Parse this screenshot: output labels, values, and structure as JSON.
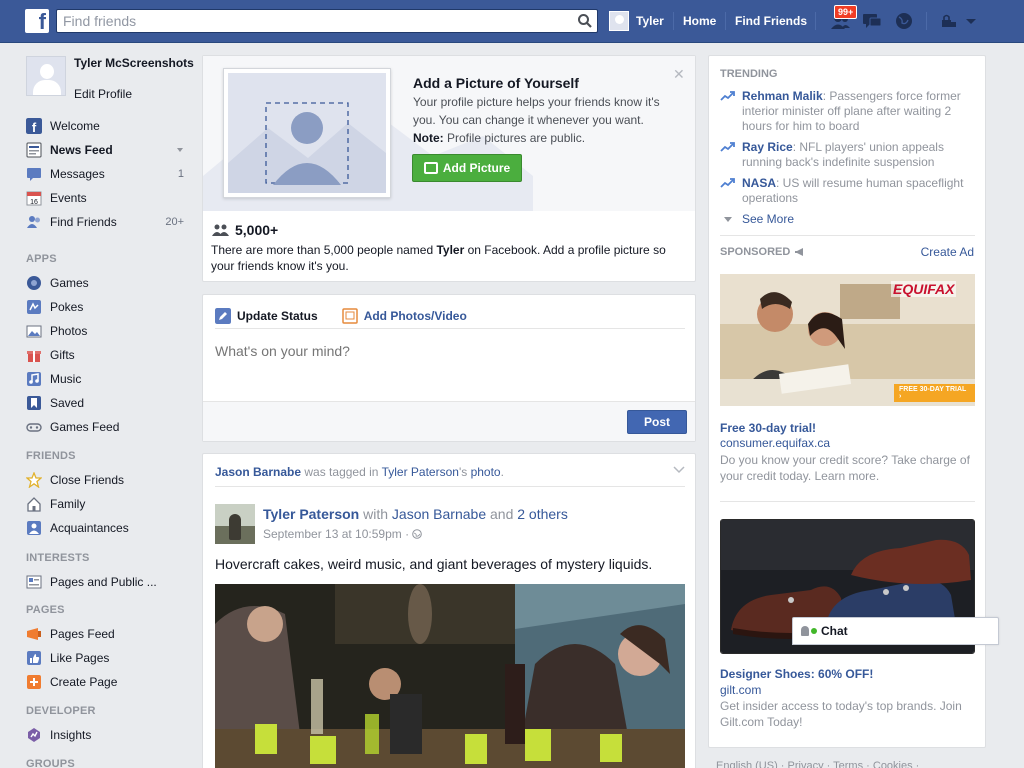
{
  "topbar": {
    "search_placeholder": "Find friends",
    "user_name": "Tyler",
    "home": "Home",
    "find_friends": "Find Friends",
    "notifications_badge": "99+"
  },
  "profile": {
    "name": "Tyler McScreenshots",
    "edit": "Edit Profile"
  },
  "nav_main": [
    {
      "label": "Welcome",
      "count": "",
      "icon": "fb-icon"
    },
    {
      "label": "News Feed",
      "count": "",
      "icon": "news-feed-icon"
    },
    {
      "label": "Messages",
      "count": "1",
      "icon": "messages-icon"
    },
    {
      "label": "Events",
      "count": "",
      "icon": "events-icon"
    },
    {
      "label": "Find Friends",
      "count": "20+",
      "icon": "find-friends-icon"
    }
  ],
  "sections": {
    "apps": "APPS",
    "friends": "FRIENDS",
    "interests": "INTERESTS",
    "pages": "PAGES",
    "developer": "DEVELOPER",
    "groups": "GROUPS"
  },
  "nav_apps": [
    {
      "label": "Games",
      "icon": "games-icon"
    },
    {
      "label": "Pokes",
      "icon": "pokes-icon"
    },
    {
      "label": "Photos",
      "icon": "photos-icon"
    },
    {
      "label": "Gifts",
      "icon": "gifts-icon"
    },
    {
      "label": "Music",
      "icon": "music-icon"
    },
    {
      "label": "Saved",
      "icon": "saved-icon"
    },
    {
      "label": "Games Feed",
      "icon": "games-feed-icon"
    }
  ],
  "nav_friends": [
    {
      "label": "Close Friends",
      "icon": "star-icon"
    },
    {
      "label": "Family",
      "icon": "family-icon"
    },
    {
      "label": "Acquaintances",
      "icon": "acquaintances-icon"
    }
  ],
  "nav_interests": [
    {
      "label": "Pages and Public ...",
      "icon": "pages-public-icon"
    }
  ],
  "nav_pages": [
    {
      "label": "Pages Feed",
      "icon": "pages-feed-icon"
    },
    {
      "label": "Like Pages",
      "icon": "like-icon"
    },
    {
      "label": "Create Page",
      "icon": "create-page-icon"
    }
  ],
  "nav_developer": [
    {
      "label": "Insights",
      "icon": "insights-icon"
    }
  ],
  "add_picture": {
    "title": "Add a Picture of Yourself",
    "text": "Your profile picture helps your friends know it's you. You can change it whenever you want.",
    "note_label": "Note:",
    "note_text": " Profile pictures are public.",
    "button": "Add Picture",
    "count": "5,000+",
    "desc_pre": "There are more than 5,000 people named ",
    "desc_name": "Tyler",
    "desc_post": " on Facebook. Add a profile picture so your friends know it's you."
  },
  "status": {
    "tab_update": "Update Status",
    "tab_photos": "Add Photos/Video",
    "placeholder": "What's on your mind?",
    "post": "Post"
  },
  "story": {
    "tagger": "Jason Barnabe",
    "tagged_text": " was tagged in ",
    "owner": "Tyler Paterson",
    "owner_suffix": "'s ",
    "photo": "photo",
    "period": ".",
    "author": "Tyler Paterson",
    "with": " with ",
    "with_name": "Jason Barnabe",
    "and": " and ",
    "others": "2 others",
    "date": "September 13 at 10:59pm · ",
    "text": "Hovercraft cakes, weird music, and giant beverages of mystery liquids."
  },
  "trending": {
    "header": "TRENDING",
    "items": [
      {
        "topic": "Rehman Malik",
        "text": ": Passengers force former interior minister off plane after waiting 2 hours for him to board"
      },
      {
        "topic": "Ray Rice",
        "text": ": NFL players' union appeals running back's indefinite suspension"
      },
      {
        "topic": "NASA",
        "text": ": US will resume human spaceflight operations"
      }
    ],
    "see_more": "See More"
  },
  "sponsored": {
    "header": "SPONSORED",
    "create_ad": "Create Ad",
    "ads": [
      {
        "brand": "EQUIFAX",
        "ribbon": "FREE 30-DAY TRIAL ›",
        "title": "Free 30-day trial!",
        "url": "consumer.equifax.ca",
        "desc": "Do you know your credit score? Take charge of your credit today. Learn more."
      },
      {
        "title": "Designer Shoes: 60% OFF!",
        "url": "gilt.com",
        "desc": "Get insider access to today's top brands. Join Gilt.com Today!"
      }
    ]
  },
  "chat": {
    "label": "Chat"
  },
  "footer": {
    "text": "English (US) · Privacy · Terms · Cookies ·"
  },
  "colors": {
    "brand": "#3b5998",
    "link": "#365899",
    "green": "#4bae3e",
    "badge": "#f03d25"
  }
}
